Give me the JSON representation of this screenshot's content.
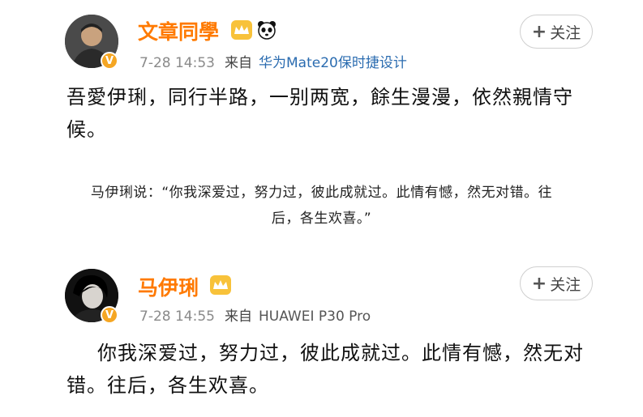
{
  "post1": {
    "username": "文章同學",
    "time": "7-28 14:53",
    "source_prefix": "来自",
    "device": "华为Mate20保时捷设计",
    "follow_label": "关注",
    "text_line1": "吾愛伊琍，同行半路，一别两宽，餘生漫漫，依然親情守",
    "text_line2": "候。",
    "badges": [
      "crown-icon",
      "panda-icon"
    ]
  },
  "quote": {
    "line1": "马伊琍说：“你我深爱过，努力过，彼此成就过。此情有憾，然无对错。往",
    "line2": "后，各生欢喜。”"
  },
  "post2": {
    "username": "马伊琍",
    "time": "7-28 14:55",
    "source_prefix": "来自",
    "device": "HUAWEI P30 Pro",
    "follow_label": "关注",
    "text_line1": "你我深爱过，努力过，彼此成就过。此情有憾，然无对",
    "text_line2": "错。往后，各生欢喜。",
    "badges": [
      "crown-icon"
    ]
  },
  "colors": {
    "username": "#ff7a00",
    "verified_badge": "#f5a623",
    "meta_gray": "#8a8a8a"
  }
}
